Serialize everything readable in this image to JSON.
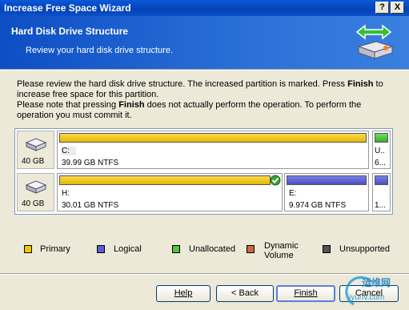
{
  "window": {
    "title": "Increase Free Space Wizard",
    "help_btn": "?",
    "close_btn": "X"
  },
  "header": {
    "title": "Hard Disk Drive Structure",
    "subtitle": "Review your hard disk drive structure."
  },
  "description": {
    "line1_pre": "Please review the hard disk drive structure. The increased partition is marked. Press ",
    "line1_bold": "Finish",
    "line1_post": " to increase free space for this partition.",
    "line2_pre": "Please note that pressing ",
    "line2_bold": "Finish",
    "line2_post": " does not actually perform the operation. To perform the operation you must commit it."
  },
  "disks": [
    {
      "size": "40 GB",
      "partitions": [
        {
          "letter": "C:",
          "info": "39.99 GB  NTFS",
          "type": "Primary"
        },
        {
          "letter": "U..",
          "info": "6...",
          "type": "Unallocated"
        }
      ]
    },
    {
      "size": "40 GB",
      "partitions": [
        {
          "letter": "H:",
          "info": "30.01 GB  NTFS",
          "type": "Primary",
          "marked": true
        },
        {
          "letter": "E:",
          "info": "9.974 GB  NTFS",
          "type": "Logical"
        },
        {
          "letter": "",
          "info": "1...",
          "type": "Logical"
        }
      ]
    }
  ],
  "legend": [
    {
      "label": "Primary",
      "color": "#f0c800"
    },
    {
      "label": "Logical",
      "color": "#5a5ed0"
    },
    {
      "label": "Unallocated",
      "color": "#5ac040"
    },
    {
      "label": "Dynamic Volume",
      "color": "#c86a40"
    },
    {
      "label": "Unsupported",
      "color": "#555555"
    }
  ],
  "buttons": {
    "help": "Help",
    "back": "< Back",
    "finish": "Finish",
    "cancel": "Cancel"
  },
  "watermark": {
    "cn": "运维网",
    "url": "iyunv.com"
  }
}
